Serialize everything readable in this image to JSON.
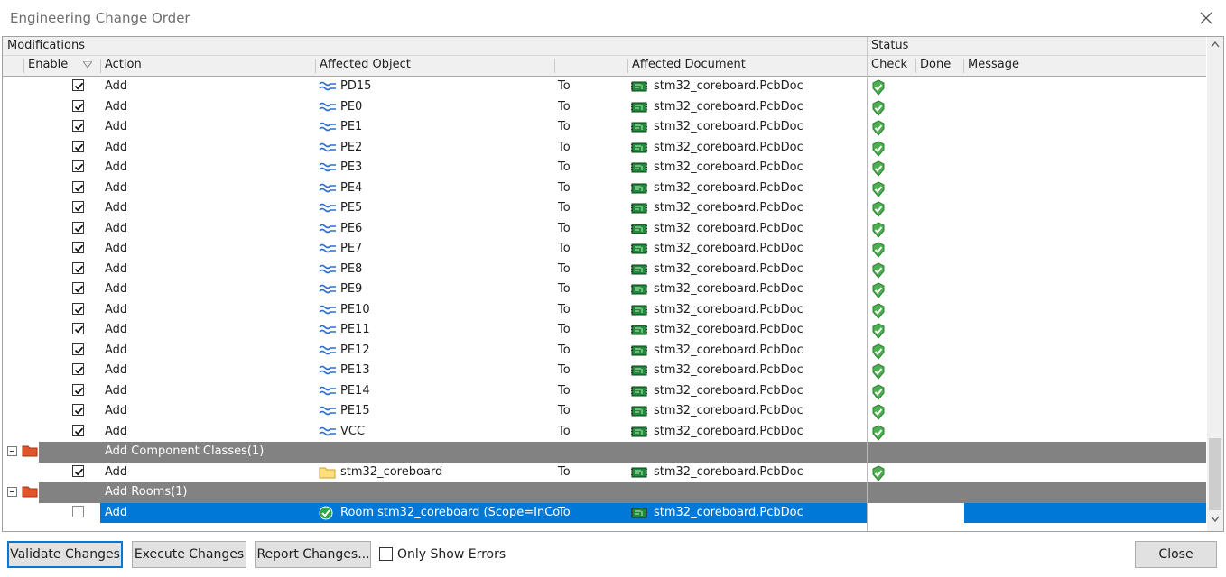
{
  "window": {
    "title": "Engineering Change Order"
  },
  "header": {
    "modifications": "Modifications",
    "status": "Status",
    "enable": "Enable",
    "action": "Action",
    "affected_object": "Affected Object",
    "affected_document": "Affected Document",
    "check": "Check",
    "done": "Done",
    "message": "Message"
  },
  "rows": [
    {
      "type": "item",
      "enabled": true,
      "action": "Add",
      "object": "PD15",
      "obj_icon": "net-icon",
      "to": "To",
      "document": "stm32_coreboard.PcbDoc",
      "check": true
    },
    {
      "type": "item",
      "enabled": true,
      "action": "Add",
      "object": "PE0",
      "obj_icon": "net-icon",
      "to": "To",
      "document": "stm32_coreboard.PcbDoc",
      "check": true
    },
    {
      "type": "item",
      "enabled": true,
      "action": "Add",
      "object": "PE1",
      "obj_icon": "net-icon",
      "to": "To",
      "document": "stm32_coreboard.PcbDoc",
      "check": true
    },
    {
      "type": "item",
      "enabled": true,
      "action": "Add",
      "object": "PE2",
      "obj_icon": "net-icon",
      "to": "To",
      "document": "stm32_coreboard.PcbDoc",
      "check": true
    },
    {
      "type": "item",
      "enabled": true,
      "action": "Add",
      "object": "PE3",
      "obj_icon": "net-icon",
      "to": "To",
      "document": "stm32_coreboard.PcbDoc",
      "check": true
    },
    {
      "type": "item",
      "enabled": true,
      "action": "Add",
      "object": "PE4",
      "obj_icon": "net-icon",
      "to": "To",
      "document": "stm32_coreboard.PcbDoc",
      "check": true
    },
    {
      "type": "item",
      "enabled": true,
      "action": "Add",
      "object": "PE5",
      "obj_icon": "net-icon",
      "to": "To",
      "document": "stm32_coreboard.PcbDoc",
      "check": true
    },
    {
      "type": "item",
      "enabled": true,
      "action": "Add",
      "object": "PE6",
      "obj_icon": "net-icon",
      "to": "To",
      "document": "stm32_coreboard.PcbDoc",
      "check": true
    },
    {
      "type": "item",
      "enabled": true,
      "action": "Add",
      "object": "PE7",
      "obj_icon": "net-icon",
      "to": "To",
      "document": "stm32_coreboard.PcbDoc",
      "check": true
    },
    {
      "type": "item",
      "enabled": true,
      "action": "Add",
      "object": "PE8",
      "obj_icon": "net-icon",
      "to": "To",
      "document": "stm32_coreboard.PcbDoc",
      "check": true
    },
    {
      "type": "item",
      "enabled": true,
      "action": "Add",
      "object": "PE9",
      "obj_icon": "net-icon",
      "to": "To",
      "document": "stm32_coreboard.PcbDoc",
      "check": true
    },
    {
      "type": "item",
      "enabled": true,
      "action": "Add",
      "object": "PE10",
      "obj_icon": "net-icon",
      "to": "To",
      "document": "stm32_coreboard.PcbDoc",
      "check": true
    },
    {
      "type": "item",
      "enabled": true,
      "action": "Add",
      "object": "PE11",
      "obj_icon": "net-icon",
      "to": "To",
      "document": "stm32_coreboard.PcbDoc",
      "check": true
    },
    {
      "type": "item",
      "enabled": true,
      "action": "Add",
      "object": "PE12",
      "obj_icon": "net-icon",
      "to": "To",
      "document": "stm32_coreboard.PcbDoc",
      "check": true
    },
    {
      "type": "item",
      "enabled": true,
      "action": "Add",
      "object": "PE13",
      "obj_icon": "net-icon",
      "to": "To",
      "document": "stm32_coreboard.PcbDoc",
      "check": true
    },
    {
      "type": "item",
      "enabled": true,
      "action": "Add",
      "object": "PE14",
      "obj_icon": "net-icon",
      "to": "To",
      "document": "stm32_coreboard.PcbDoc",
      "check": true
    },
    {
      "type": "item",
      "enabled": true,
      "action": "Add",
      "object": "PE15",
      "obj_icon": "net-icon",
      "to": "To",
      "document": "stm32_coreboard.PcbDoc",
      "check": true
    },
    {
      "type": "item",
      "enabled": true,
      "action": "Add",
      "object": "VCC",
      "obj_icon": "net-icon",
      "to": "To",
      "document": "stm32_coreboard.PcbDoc",
      "check": true
    },
    {
      "type": "group",
      "label": "Add Component Classes(1)"
    },
    {
      "type": "item",
      "enabled": true,
      "action": "Add",
      "object": "stm32_coreboard",
      "obj_icon": "folder-icon",
      "to": "To",
      "document": "stm32_coreboard.PcbDoc",
      "check": true
    },
    {
      "type": "group",
      "label": "Add Rooms(1)"
    },
    {
      "type": "item",
      "enabled": false,
      "selected": true,
      "action": "Add",
      "object": "Room stm32_coreboard (Scope=InCo",
      "obj_icon": "room-check-icon",
      "to": "To",
      "document": "stm32_coreboard.PcbDoc",
      "check": false
    }
  ],
  "buttons": {
    "validate": "Validate Changes",
    "execute": "Execute Changes",
    "report": "Report Changes...",
    "only_errors": "Only Show Errors",
    "close": "Close"
  },
  "colors": {
    "selection": "#0078d7",
    "group_row": "#828282",
    "check_green": "#3aa845"
  }
}
